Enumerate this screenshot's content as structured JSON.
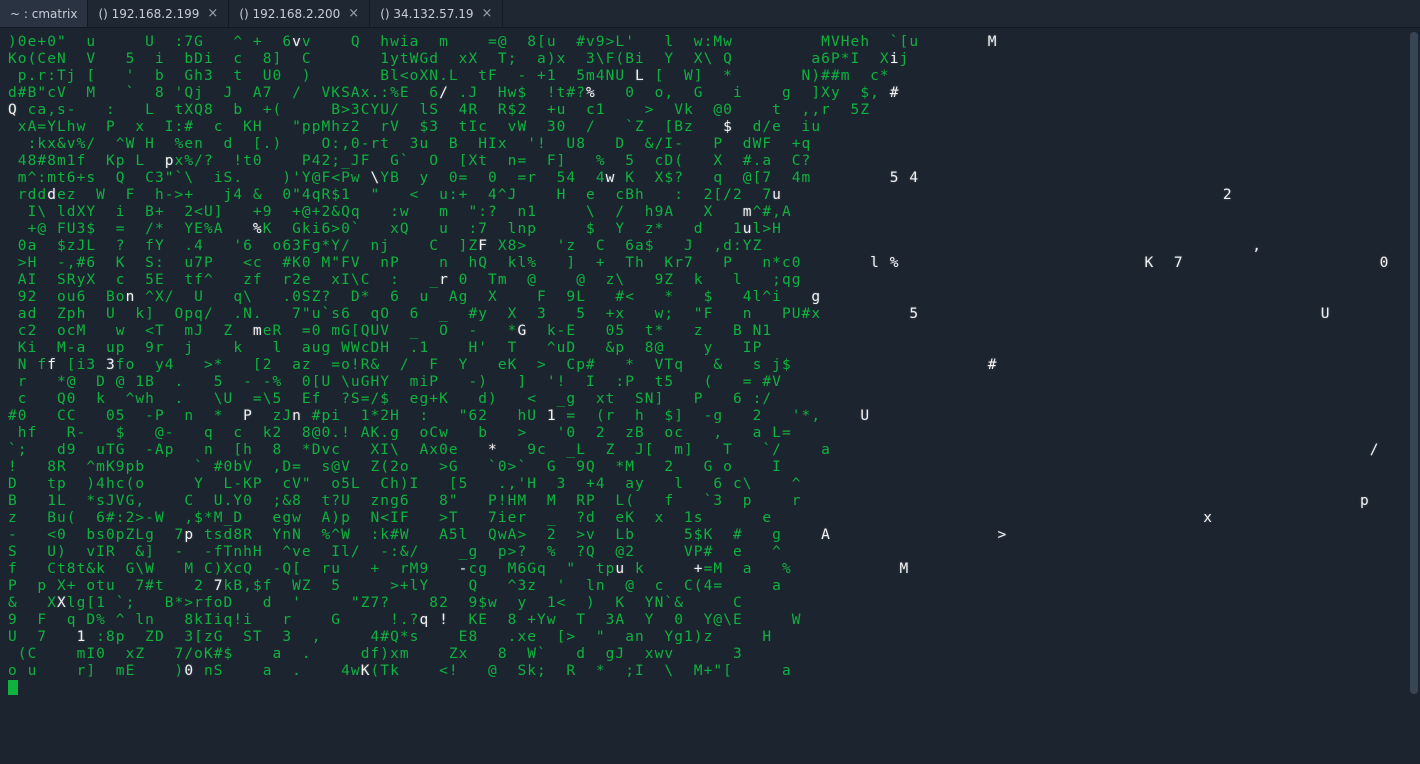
{
  "tabs": [
    {
      "label": "~ : cmatrix",
      "closable": false,
      "active": true
    },
    {
      "label": "() 192.168.2.199",
      "closable": true,
      "active": false
    },
    {
      "label": "() 192.168.2.200",
      "closable": true,
      "active": false
    },
    {
      "label": "() 34.132.57.19",
      "closable": true,
      "active": false
    }
  ],
  "colors": {
    "background": "#1c2430",
    "tabbar_bg": "#1f2733",
    "tab_active_bg": "#2a3342",
    "tab_fg": "#c7cdd6",
    "matrix_green": "#0fb23e",
    "matrix_head": "#f2f2f2",
    "scrollbar_thumb": "#3a4554"
  },
  "terminal": {
    "cols": 142,
    "lines": [
      ")0e+0\"  u     U  :7G   ^ +  6 v    Q  hwia  m    =@  8[u  #v9>L'   l  w:Mw         MVHeh  `[u",
      "Ko(CeN  V   5  i  bDi  c  8]  C       1ytWGd  xX  T;  a)x  3\\F(Bi  Y  X\\ Q        a6P*I  X@j",
      " p.r:Tj [   '  b  Gh3  t  U0  )       Bl<oXN.L  tF  - +1  5m4NU   [  W]  *       N)##m  c*",
      "d#B\"cV  M   `  8 'Qj  J  A7  /  VKSAx.:%E  6  .J  Hw$  !t#?*   0  o,  G   i    g  ]Xy  $,",
      "Q ca,s-   :   L  tXQ8  b  +(     B>3CYU/  lS  4R  R$2  +u  c1    >  Vk  @0    t  ,,r  5Z",
      " xA=YLhw  P  x  I:#  c  KH   \"ppMhz2  rV  $3  tIc  vW  30  /   `Z  [Bz   0  d/e  iu",
      "  :kx&v%/  ^W H  %en  d  [.)    O:,0-rt  3u  B  HIx  '!  U8   D  &/I-   P  dWF  +q",
      " 48#8m1f  Kp L  Mx%/?  !t0    P42;_JF  G`  O  [Xt  n=  F]   %  5  cD(   X  #.a  C?",
      " m^:mt6+s  Q  C3\"`\\  iS.    )'Y@F<Pw  YB  y  0=  0  =r  54  4  K  X$?   q  @[7  4m",
      " rdd#ez  W  F  h->+   j4 &  0\"4qR$1  \"   <  u:+  4^J    H  e  cBh   :  2[/2  75",
      "  I\\ ldXY  i  B+  2<U]   +9  +@+2&Qq   :w   m  \":?  n1     \\  /  h9A   X   m^#,A",
      "  +@ FU3$  =  /*  YE%A   =K  Gki6>0`   xQ   u  :7  lnp     $  Y  z*   d   1Ll>H",
      " 0a  $zJL  ?  fY  .4   '6  o63Fg*Y/  nj    C  ]Z  X8>   'z  C  6a$   J  ,d:YZ",
      " >H  -,#6  K  S:  u7P   <c  #K0 M\"FV  nP    n  hQ  kl%   ]  +  Th  Kr7   P   n*c0",
      " AI  SRyX  c  5E  tf^   zf  r2e  xI\\C  :   _  0  Tm  @    @  z\\   9Z  k   l   ;qg",
      " 92  ou6  Bo  ^X/  U   q\\   .0SZ?  D*  6  u  Ag  X    F  9L   #<   *   $   4l^i",
      " ad  Zph  U  k]  Opq/  .N.   7\"u`s6  qO  6  _  #y  X  3   5  +x   w;  \"F   n   PU#x",
      " c2  ocM   w  <T  mJ  Z   eR  =0 mG[QUV  _  O  -   *   k-E   05  t*   z   B N1",
      " Ki  M-a  up  9r  j    k   l  aug WWcDH  .1    H'  T   ^uD   &p  8@    y   IP",
      " N f  [i3  fo  y4   >*   [2  az  =o!R&  /  F  Y   eK  >  Cp#   *  VTq   &   s j$",
      " r   *@  D @ 1B  .   5  - -%  0[U \\uGHY  miP   -)   ]  '!  I  :P  t5   (   = #V",
      " c   Q0  k  ^wh  .   \\U  =\\5  Ef  ?S=/$  eg+K   d)   <  _g  xt  SN]   P   6 :/",
      "#0   CC   05  -P  n  *  K  zJ  #pi  1*2H  :   \"62   hU   =  (r  h  $]  -g   2   '*,",
      " hf   R-   $   @-   q  c  k2  8@0.! AK.g  oCw   b   >   '0  2  zB  oc   ,   a L=",
      "`;   d9  uTG  -Ap   n  [h  8  *Dvc   XI\\  Ax0e   b   9c  _L  Z  J[  m]   T   `/    a",
      "!   8R  ^mK9pb     ` #0bV  ,D=  s@V  Z(2o   >G   `0>`  G  9Q  *M   2   G o    I",
      "D   tp  )4hc(o     Y  L-KP  cV\"  o5L  Ch)I   [5   .,'H  3  +4  ay   l   6 c\\    ^",
      "B   1L  *sJVG,    C  U.Y0  ;&8  t?U  zng6   8\"   P!HM  M  RP  L(   f   `3  p    r",
      "z   Bu(  6#:2>-W  ,$*M_D   egw  A)p  N<IF   >T   7ier  _  ?d  eK  x  1s      e",
      "-   <0  bs0pZLg  7  tsd8R  YnN  %^W  :k#W   A5l  QwA>  2  >v  Lb     5$K  #   g",
      "S   U)  vIR  &]  -  -fTnhH  ^ve  Il/  -:&/    _g  p>?  %  ?Q  @2     VP#  e   ^",
      "f   Ct8t&k  G\\W   M C)XcQ  -Q[  ru   +  rM9    cg  M6Gq  \"  tp  k     P=M  a   %",
      "P  p X+ otu  7#t   2  kB,$f  WZ  5     >+lY    Q   ^3z  '  ln  @  c  C(4=     a",
      "&   X lg[1 `;   B*>rfoD   d  '     \"Z7?    82  9$w  y  1<  )  K  YN`&     C",
      "9  F  q D% ^ ln   8kIiq!i   r    G     !.?>    KE  8 +Yw  T  3A  Y  0  Y@\\E     W",
      "U  7   1 :8p  ZD  3[zG  ST  3  ,     4#Q*s    E8   .xe  [>  \"  an  Yg1)z     H",
      " (C    mI0  xZ   7/oK#$    a  .     df)xm    Zx   8  W`   d  gJ  xwv      3",
      "o u    r]  mE    )` nS    a  .    4wb(Tk    <!   @  Sk;  R  *  ;I  \\  M+\"[     a"
    ],
    "head_positions": [
      [
        0,
        29,
        "v"
      ],
      [
        0,
        100,
        "M"
      ],
      [
        1,
        90,
        "i"
      ],
      [
        1,
        143,
        "j"
      ],
      [
        2,
        64,
        "L"
      ],
      [
        3,
        44,
        "/"
      ],
      [
        3,
        59,
        "%"
      ],
      [
        3,
        90,
        "#"
      ],
      [
        4,
        0,
        "Q"
      ],
      [
        5,
        73,
        "$"
      ],
      [
        7,
        16,
        "p"
      ],
      [
        8,
        37,
        "\\"
      ],
      [
        8,
        61,
        "w"
      ],
      [
        8,
        90,
        "5"
      ],
      [
        8,
        92,
        "4"
      ],
      [
        9,
        4,
        "d"
      ],
      [
        9,
        78,
        "u"
      ],
      [
        9,
        124,
        "2"
      ],
      [
        10,
        75,
        "m"
      ],
      [
        11,
        25,
        "%"
      ],
      [
        11,
        75,
        "u"
      ],
      [
        12,
        48,
        "F"
      ],
      [
        12,
        127,
        ","
      ],
      [
        13,
        88,
        "l"
      ],
      [
        13,
        90,
        "%"
      ],
      [
        13,
        116,
        "K"
      ],
      [
        13,
        119,
        "7"
      ],
      [
        13,
        140,
        "0"
      ],
      [
        14,
        44,
        "r"
      ],
      [
        15,
        12,
        "n"
      ],
      [
        15,
        82,
        "g"
      ],
      [
        16,
        92,
        "5"
      ],
      [
        16,
        134,
        "U"
      ],
      [
        17,
        25,
        "m"
      ],
      [
        17,
        52,
        "G"
      ],
      [
        19,
        4,
        "f"
      ],
      [
        19,
        10,
        "3"
      ],
      [
        19,
        100,
        "#"
      ],
      [
        22,
        24,
        "P"
      ],
      [
        22,
        29,
        "n"
      ],
      [
        22,
        55,
        "1"
      ],
      [
        22,
        87,
        "U"
      ],
      [
        24,
        49,
        "*"
      ],
      [
        24,
        139,
        "/"
      ],
      [
        27,
        138,
        "p"
      ],
      [
        28,
        122,
        "x"
      ],
      [
        29,
        18,
        "p"
      ],
      [
        29,
        83,
        "A"
      ],
      [
        29,
        101,
        ">"
      ],
      [
        31,
        91,
        "M"
      ],
      [
        31,
        46,
        "-"
      ],
      [
        31,
        62,
        "u"
      ],
      [
        31,
        70,
        "+"
      ],
      [
        32,
        21,
        "7"
      ],
      [
        37,
        18,
        "0"
      ],
      [
        37,
        36,
        "K"
      ],
      [
        33,
        5,
        "X"
      ],
      [
        34,
        42,
        "q"
      ],
      [
        34,
        44,
        "!"
      ],
      [
        35,
        7,
        "1"
      ]
    ],
    "cursor": {
      "row": 38,
      "col": 0
    }
  }
}
